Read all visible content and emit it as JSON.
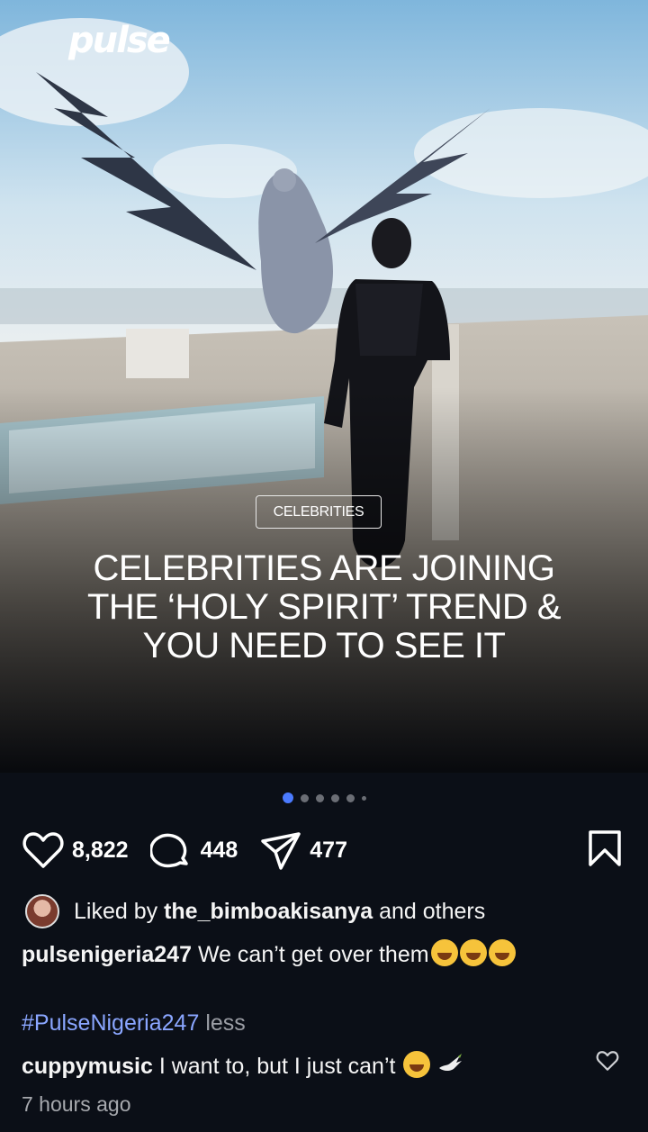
{
  "post": {
    "logo_text": "pulse",
    "category": "CELEBRITIES",
    "headline_lines": [
      "CELEBRITIES ARE JOINING",
      "THE ‘HOLY SPIRIT’ TREND &",
      "YOU NEED TO SEE IT"
    ]
  },
  "carousel": {
    "dot_count": 6,
    "active_index": 0
  },
  "actions": {
    "likes": "8,822",
    "comments": "448",
    "shares": "477",
    "icons": [
      "heart-icon",
      "comment-icon",
      "share-icon",
      "bookmark-icon"
    ]
  },
  "liked_by": {
    "prefix": "Liked by",
    "user": "the_bimboakisanya",
    "suffix": "and others"
  },
  "caption": {
    "user": "pulsenigeria247",
    "text": "We can’t get over them"
  },
  "hashtag": {
    "tag": "#PulseNigeria247",
    "less": "less"
  },
  "comment": {
    "user": "cuppymusic",
    "text": "I want to, but I just can’t"
  },
  "timestamp": "7 hours ago",
  "colors": {
    "background": "#0b0f17",
    "accent": "#4b7bff",
    "hashtag": "#8aa6ff"
  }
}
